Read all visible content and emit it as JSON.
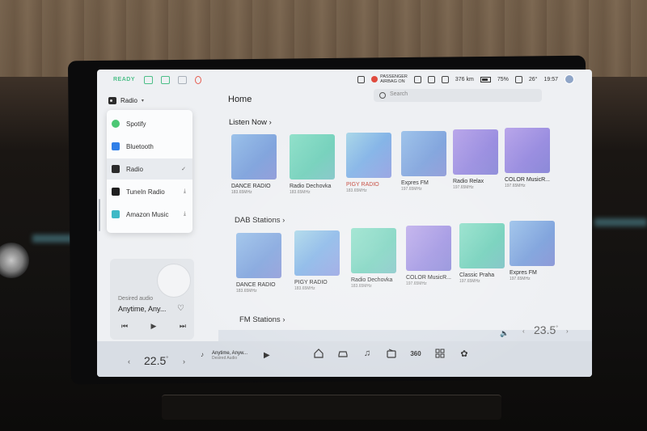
{
  "status_bar": {
    "ready_label": "READY",
    "passenger_airbag": "PASSENGER\nAIRBAG ON",
    "range": "376 km",
    "battery": "75%",
    "outside_temp": "26°",
    "clock": "19:57"
  },
  "source_selector": {
    "current": "Radio",
    "items": [
      {
        "label": "Spotify",
        "icon": "spotify-icon"
      },
      {
        "label": "Bluetooth",
        "icon": "bluetooth-icon"
      },
      {
        "label": "Radio",
        "icon": "radio-icon",
        "selected": true,
        "mark": "✓"
      },
      {
        "label": "TuneIn Radio",
        "icon": "tunein-icon",
        "mark": "⤓"
      },
      {
        "label": "Amazon Music",
        "icon": "amazon-music-icon",
        "mark": "⤓"
      }
    ]
  },
  "mini_player": {
    "subtitle": "Desired audio",
    "title": "Anytime, Any..."
  },
  "main": {
    "title": "Home",
    "search_placeholder": "Search",
    "sections": [
      {
        "title": "Listen Now",
        "cards": [
          {
            "name": "DANCE RADIO",
            "freq": "183.65MHz"
          },
          {
            "name": "Radio Dechovka",
            "freq": "183.65MHz"
          },
          {
            "name": "PIGY RADIO",
            "freq": "183.65MHz"
          },
          {
            "name": "Expres FM",
            "freq": "197.65MHz"
          },
          {
            "name": "Radio Relax",
            "freq": "197.65MHz"
          },
          {
            "name": "COLOR MusicR...",
            "freq": "197.65MHz"
          }
        ]
      },
      {
        "title": "DAB Stations",
        "cards": [
          {
            "name": "DANCE RADIO",
            "freq": "183.65MHz"
          },
          {
            "name": "PIGY RADIO",
            "freq": "183.65MHz"
          },
          {
            "name": "Radio Dechovka",
            "freq": "183.65MHz"
          },
          {
            "name": "COLOR MusicR...",
            "freq": "197.65MHz"
          },
          {
            "name": "Classic Praha",
            "freq": "197.65MHz"
          },
          {
            "name": "Expres FM",
            "freq": "197.65MHz"
          }
        ]
      },
      {
        "title": "FM Stations",
        "cards": []
      }
    ]
  },
  "dock": {
    "left_temp": "22.5",
    "right_temp": "23.5",
    "temp_unit": "°",
    "media_title": "Anytime, Anyw...",
    "media_subtitle": "Desired Audio",
    "icon_360_label": "360"
  }
}
